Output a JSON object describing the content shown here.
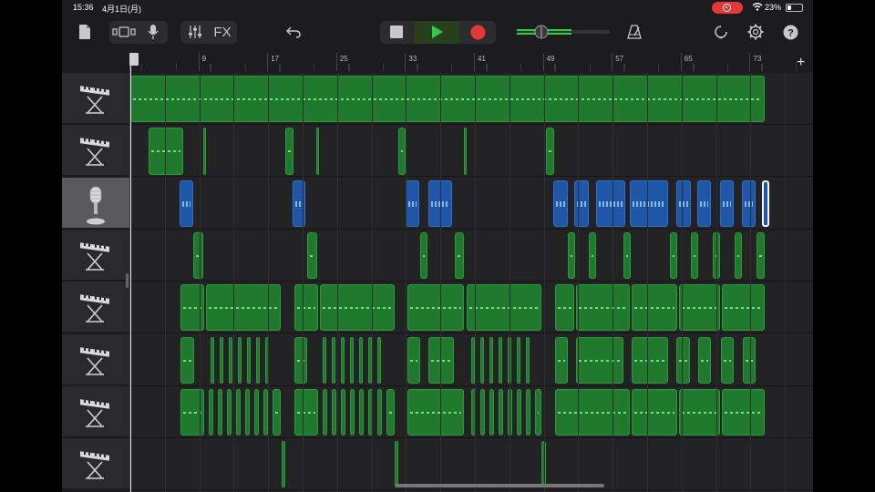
{
  "status": {
    "time": "15:36",
    "date": "4月1日(月)",
    "battery": "23%"
  },
  "toolbar": {
    "fx_label": "FX",
    "icons": [
      "document-icon",
      "track-view-icon",
      "mic-icon",
      "mixer-icon",
      "fx-button",
      "undo-icon",
      "stop-icon",
      "play-icon",
      "record-icon",
      "master-volume-slider",
      "metronome-icon",
      "loop-icon",
      "settings-icon",
      "help-icon"
    ],
    "accent_play": "#2ecc40",
    "accent_record": "#e53935"
  },
  "ruler": {
    "labels": [
      "1",
      "9",
      "17",
      "25",
      "33",
      "41",
      "49",
      "57",
      "65",
      "73"
    ],
    "add_label": "+"
  },
  "tracks": [
    {
      "instrument": "keyboard-icon",
      "selected": false,
      "color": "green"
    },
    {
      "instrument": "keyboard-icon",
      "selected": false,
      "color": "green"
    },
    {
      "instrument": "microphone-icon",
      "selected": true,
      "color": "blue"
    },
    {
      "instrument": "keyboard-icon",
      "selected": false,
      "color": "green"
    },
    {
      "instrument": "keyboard-icon",
      "selected": false,
      "color": "green"
    },
    {
      "instrument": "keyboard-icon",
      "selected": false,
      "color": "green"
    },
    {
      "instrument": "keyboard-icon",
      "selected": false,
      "color": "green"
    },
    {
      "instrument": "keyboard-icon",
      "selected": false,
      "color": "green"
    }
  ]
}
